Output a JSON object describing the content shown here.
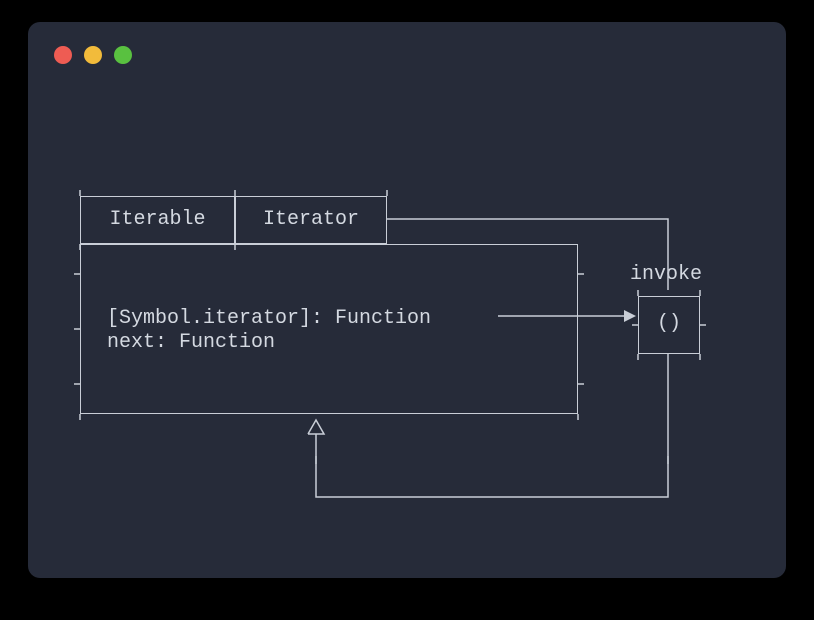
{
  "tabs": {
    "left": "Iterable",
    "right": "Iterator"
  },
  "body": {
    "line1": "[Symbol.iterator]: Function",
    "line2": "next: Function"
  },
  "invoke": {
    "label": "invoke",
    "parens": "()"
  },
  "colors": {
    "bg": "#262b39",
    "stroke": "#c9ced7",
    "text": "#d4d9e1",
    "red": "#ee5c53",
    "yellow": "#f2bb3b",
    "green": "#59c140"
  }
}
